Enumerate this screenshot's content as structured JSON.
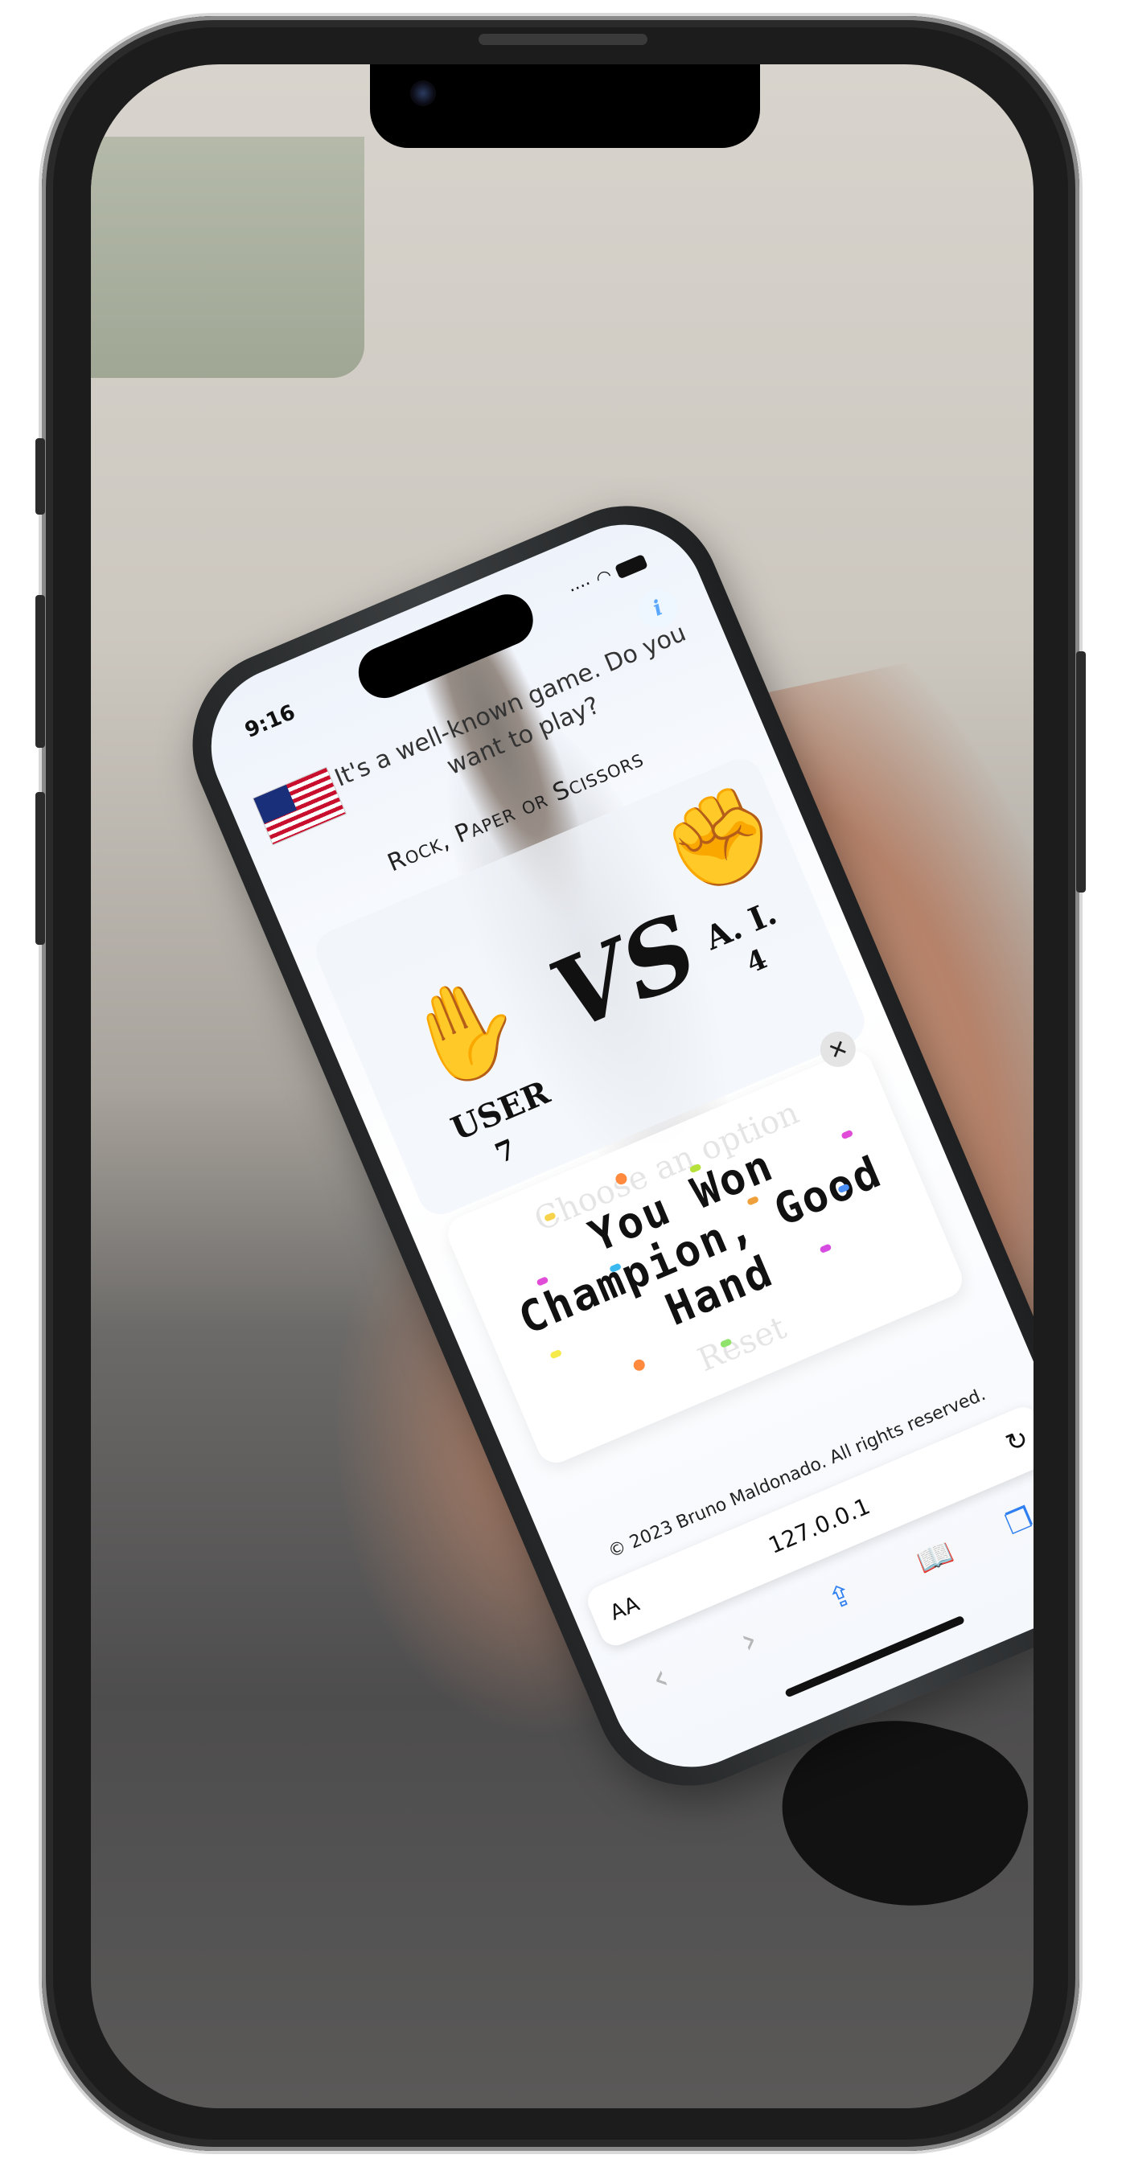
{
  "status_bar": {
    "time": "9:16"
  },
  "page": {
    "info_icon_glyph": "i",
    "intro": "It's a well-known game. Do you want to play?",
    "game_title": "Rock, Paper or Scissors",
    "language_flag": "us-flag-icon"
  },
  "scoreboard": {
    "user_label": "USER",
    "user_score": "7",
    "vs_label": "VS",
    "ai_label": "A. I.",
    "ai_score": "4",
    "user_choice_icon": "open-hand-icon",
    "ai_choice_icon": "fist-icon"
  },
  "result_modal": {
    "close_glyph": "✕",
    "message_line1": "You Won",
    "message_line2": "Champion, Good",
    "message_line3": "Hand",
    "faded_heading": "Choose an option",
    "faded_button": "Reset"
  },
  "footer": {
    "copyright": "© 2023 Bruno Maldonado. All rights reserved."
  },
  "browser": {
    "aa_label": "AA",
    "url": "127.0.0.1",
    "reload_glyph": "↻",
    "back_glyph": "‹",
    "forward_glyph": "›"
  },
  "colors": {
    "accent": "#2f7ff0",
    "info": "#5aa7ff"
  }
}
